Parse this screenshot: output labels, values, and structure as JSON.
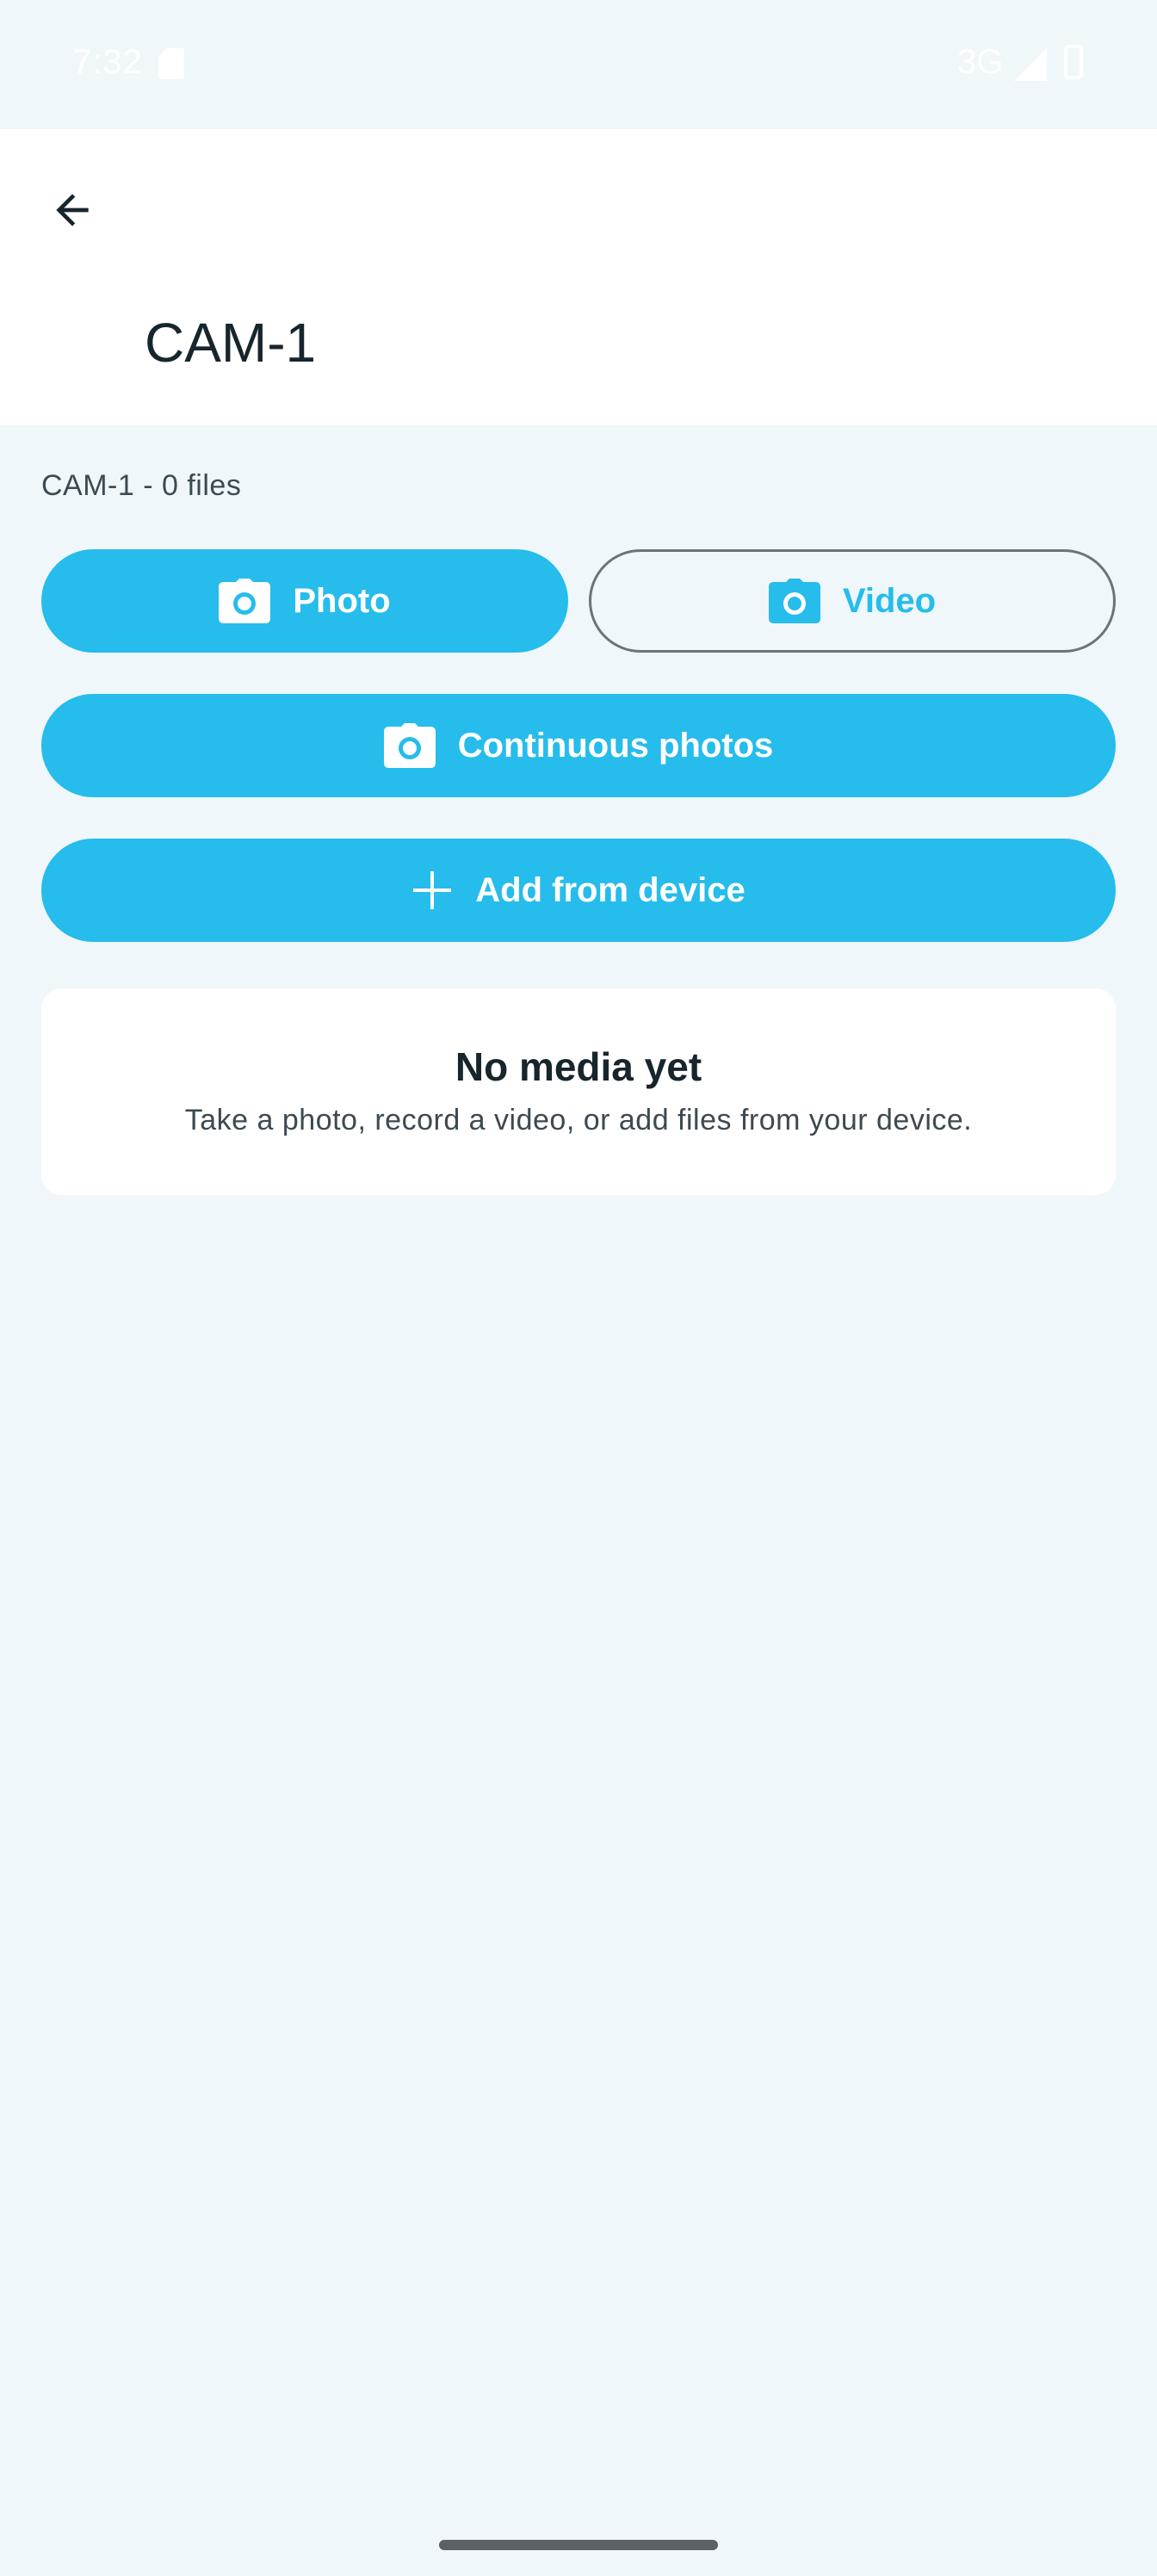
{
  "status_bar": {
    "time": "7:32",
    "network": "3G",
    "icons": [
      "sd-card-icon",
      "signal-icon",
      "battery-icon"
    ]
  },
  "app_bar": {
    "title": "CAM-1",
    "back_icon": "arrow-back-icon"
  },
  "summary": {
    "caption": "CAM-1 - 0 files"
  },
  "actions": {
    "photo_label": "Photo",
    "video_label": "Video",
    "continuous_label": "Continuous photos",
    "add_label": "Add from device",
    "icons": [
      "camera-icon",
      "plus-icon"
    ]
  },
  "empty_state": {
    "title": "No media yet",
    "subtitle": "Take a photo, record a video, or add files from your device."
  },
  "colors": {
    "accent": "#26bcec",
    "background": "#eff7fb",
    "surface": "#ffffff",
    "text": "#17252d"
  }
}
